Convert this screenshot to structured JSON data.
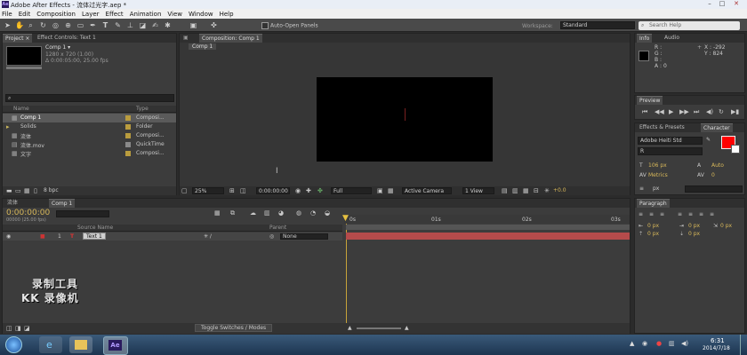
{
  "window": {
    "title": "Adobe After Effects - 流体过光字.aep *",
    "app_icon": "Ae"
  },
  "menu": [
    "File",
    "Edit",
    "Composition",
    "Layer",
    "Effect",
    "Animation",
    "View",
    "Window",
    "Help"
  ],
  "toolbar": {
    "auto_open": "Auto-Open Panels",
    "workspace_label": "Workspace:",
    "workspace_value": "Standard",
    "search_placeholder": "Search Help"
  },
  "project": {
    "tabs": [
      "Project ×",
      "Effect Controls: Text 1"
    ],
    "comp_name": "Comp 1 ▾",
    "comp_info1": "1280 x 720 (1.00)",
    "comp_info2": "Δ 0:00:05:00, 25.00 fps",
    "col_name": "Name",
    "col_type": "Type",
    "items": [
      {
        "name": "Comp 1",
        "type": "Composi..."
      },
      {
        "name": "Solids",
        "type": "Folder"
      },
      {
        "name": "流体",
        "type": "Composi..."
      },
      {
        "name": "流体.mov",
        "type": "QuickTime"
      },
      {
        "name": "文字",
        "type": "Composi..."
      }
    ],
    "bpc": "8 bpc"
  },
  "composition": {
    "tab": "Composition: Comp 1",
    "subtab": "Comp 1",
    "zoom": "25%",
    "timecode": "0:00:00:00",
    "quality": "Full",
    "camera": "Active Camera",
    "views": "1 View",
    "exposure": "+0.0"
  },
  "info": {
    "tabs": [
      "Info",
      "Audio"
    ],
    "r": "R :",
    "g": "G :",
    "b": "B :",
    "a": "A : 0",
    "x": "X : -292",
    "y": "Y : 824"
  },
  "preview": {
    "tab": "Preview"
  },
  "character": {
    "tabs": [
      "Effects & Presets",
      "Character"
    ],
    "font": "Adobe Heiti Std",
    "style": "R",
    "size": "106 px",
    "leading": "Auto",
    "kerning": "Metrics",
    "tracking": "0",
    "stroke": "px"
  },
  "paragraph": {
    "tab": "Paragraph",
    "v1": "0 px",
    "v2": "0 px",
    "v3": "0 px",
    "v4": "0 px",
    "v5": "0 px",
    "v6": "0 px"
  },
  "timeline": {
    "tabs": [
      "流体",
      "Comp 1"
    ],
    "timecode": "0:00:00:00",
    "frames": "00000 (25.00 fps)",
    "col_source": "Source Name",
    "col_parent": "Parent",
    "layer_num": "1",
    "layer_name": "Text 1",
    "parent_value": "None",
    "ruler": [
      "0s",
      "01s",
      "02s",
      "03s"
    ],
    "toggle": "Toggle Switches / Modes"
  },
  "watermark": {
    "line1": "录制工具",
    "line2": "KK 录像机"
  },
  "taskbar": {
    "app": "Ae",
    "time": "6:31",
    "date": "2014/7/18"
  }
}
